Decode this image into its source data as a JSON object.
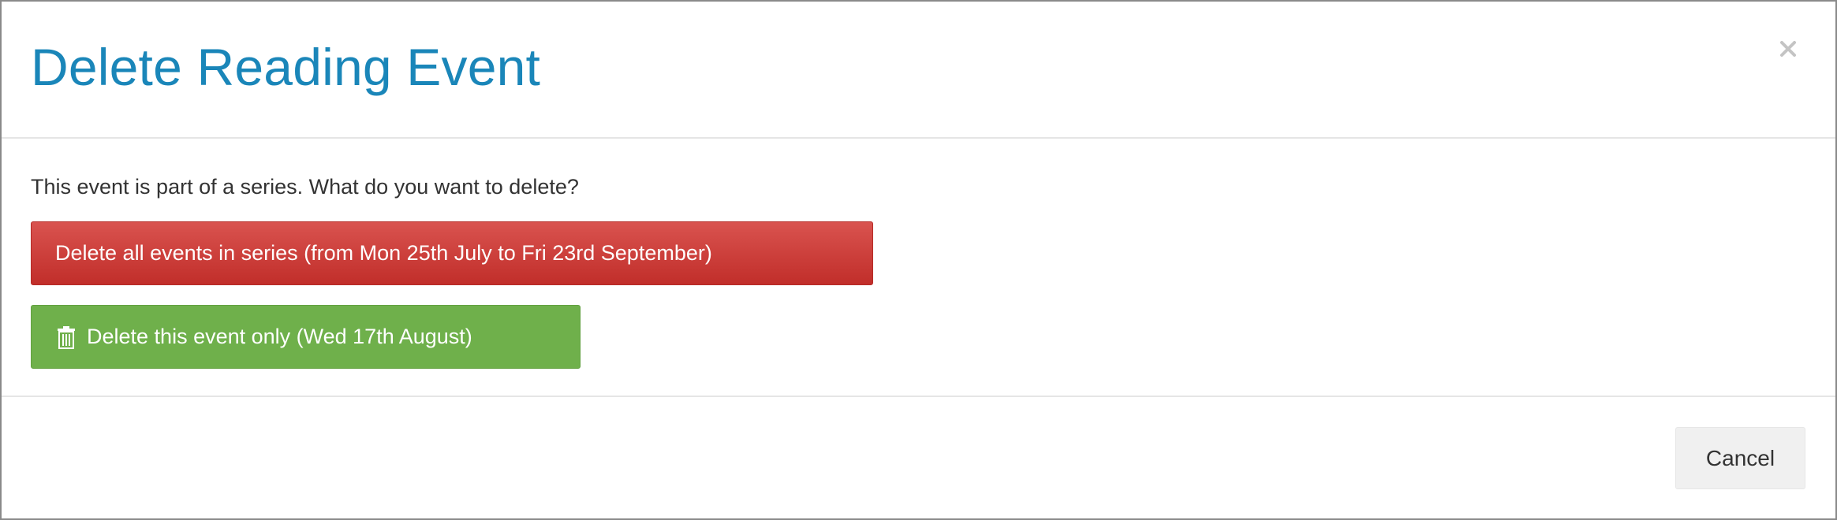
{
  "dialog": {
    "title": "Delete Reading Event",
    "close_icon": "close-icon",
    "prompt": "This event is part of a series. What do you want to delete?"
  },
  "actions": {
    "delete_series_label": "Delete all events in series (from Mon 25th July to Fri 23rd September)",
    "delete_single_label": "Delete this event only (Wed 17th August)",
    "delete_single_icon": "trash-icon"
  },
  "footer": {
    "cancel_label": "Cancel"
  },
  "colors": {
    "title": "#1a86b9",
    "danger": "#d9534f",
    "success": "#6fb04b",
    "cancel_bg": "#f0f0f0"
  }
}
